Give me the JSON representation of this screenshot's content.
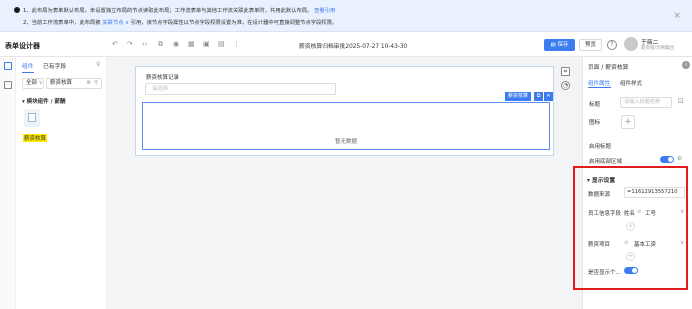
{
  "notice": {
    "line1": "1、此布局为表单默认布局，未设置独立布局的节点读取此布局；工作流表单与其他工作流关联此表单时，共用此默认布局。",
    "line1_link": "查看引用",
    "line2_pre": "2、当前工作流表单中，此布局被",
    "line2_count": "关联节点",
    "line2_post": "引用，该节点字段属性以节点字段权限设置为准，在设计器中可直接调整节点字段权限。",
    "close": "×"
  },
  "header": {
    "title": "表单设计器",
    "doc_title": "薪资核算归档审批2025-07-27 10-43-30",
    "save": "保存",
    "preview": "预览",
    "help": "?",
    "user_name": "于薇二",
    "user_sub": "薪资组/示例集团"
  },
  "toolbar_icons": [
    "undo-icon",
    "redo-icon",
    "code-icon",
    "layout-icon",
    "eye-icon",
    "grid-icon",
    "save-draft-icon",
    "print-icon",
    "more-icon"
  ],
  "left_panel": {
    "tabs": [
      "组件",
      "已有字段"
    ],
    "filter_all": "全部",
    "filter_search": "薪资核算",
    "group": "▾ 模块组件 / 薪酬",
    "item_label": "薪资核算"
  },
  "canvas": {
    "form_title": "薪资核算记录",
    "form_placeholder": "请选择",
    "subtable_tag": "薪资核算",
    "empty": "暂无数据"
  },
  "right_panel": {
    "crumb": "页面 / 薪资核算",
    "tabs": [
      "组件属性",
      "组件样式"
    ],
    "title_label": "标题",
    "title_placeholder": "请输入标题名称",
    "icon_label": "图标",
    "fold_label": "启用标题",
    "area_label": "启用底部区域",
    "section": "▾ 显示设置",
    "source_label": "数据来源",
    "source_value": "=11612913557210",
    "emp_label": "员工信息字段",
    "emp_name": "姓名",
    "emp_id": "工号",
    "item_label": "薪资项目",
    "item_value": "基本工资",
    "show_label": "是否显示个..."
  }
}
